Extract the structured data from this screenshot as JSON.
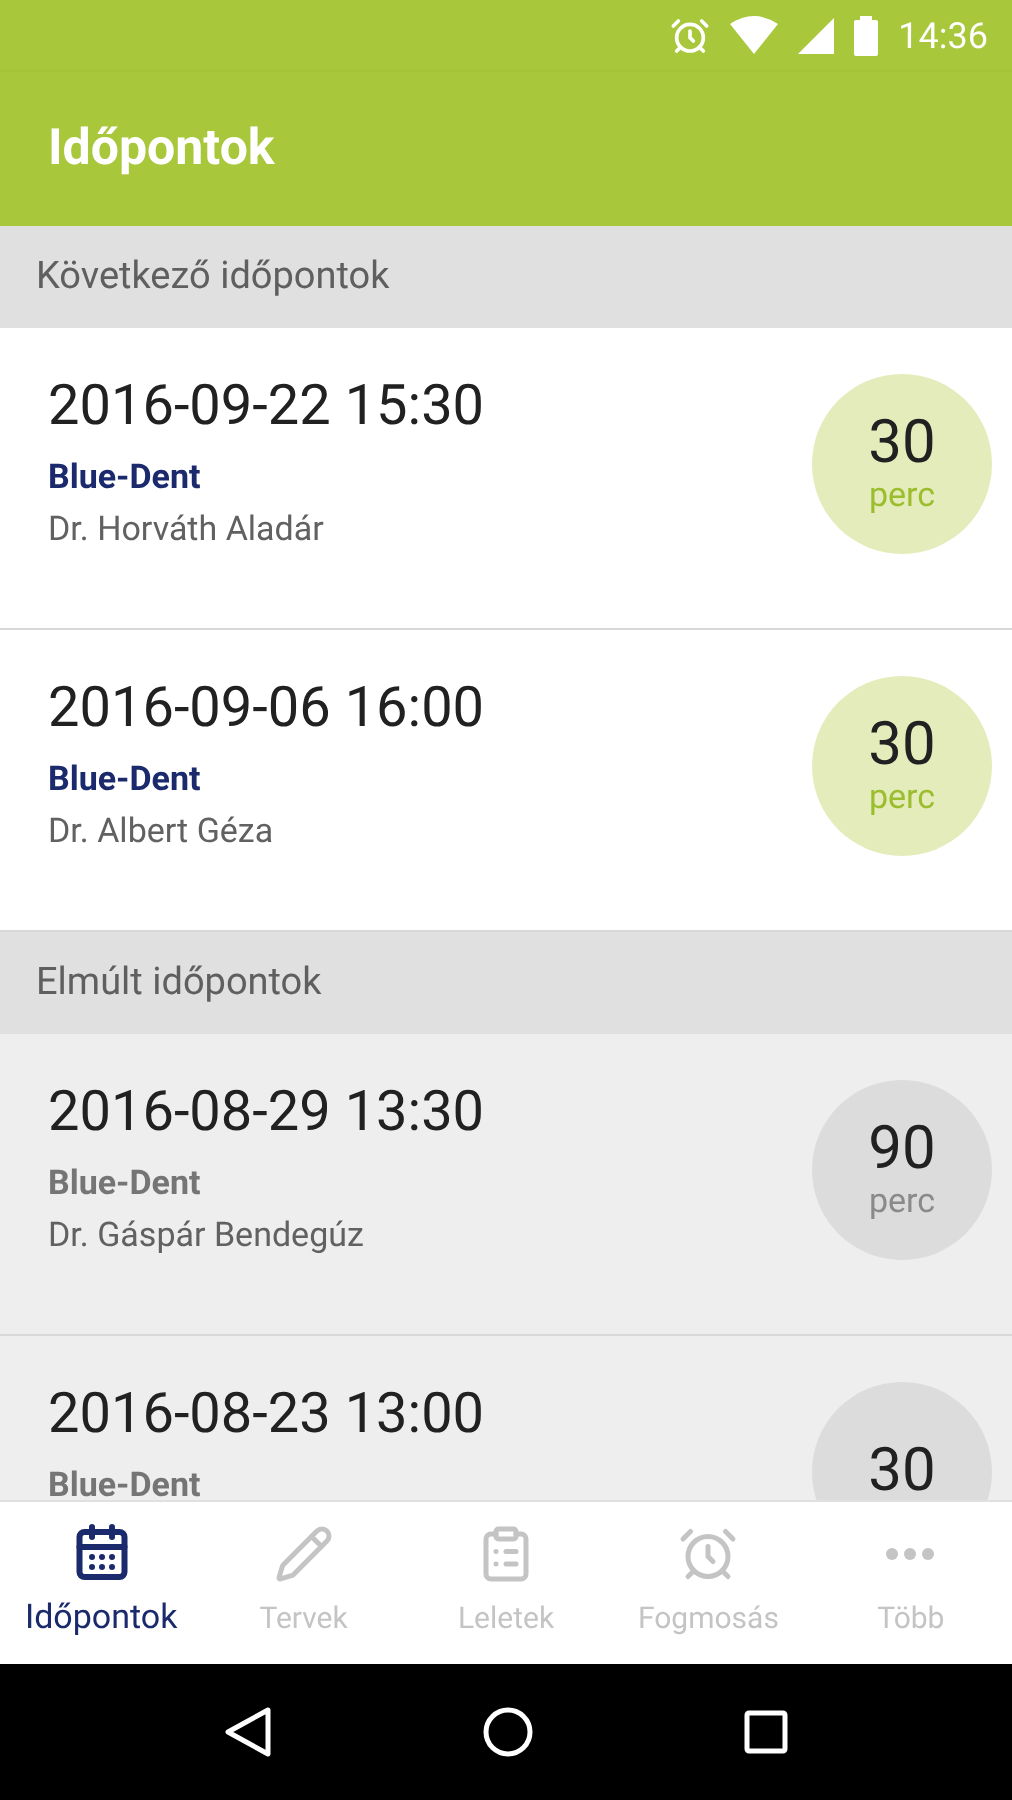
{
  "status_bar": {
    "time": "14:36"
  },
  "app_bar": {
    "title": "Időpontok"
  },
  "sections": [
    {
      "title": "Következő időpontok",
      "kind": "upcoming",
      "appointments": [
        {
          "datetime": "2016-09-22 15:30",
          "clinic": "Blue-Dent",
          "doctor": "Dr. Horváth Aladár",
          "duration": "30",
          "unit": "perc"
        },
        {
          "datetime": "2016-09-06 16:00",
          "clinic": "Blue-Dent",
          "doctor": "Dr. Albert Géza",
          "duration": "30",
          "unit": "perc"
        }
      ]
    },
    {
      "title": "Elmúlt időpontok",
      "kind": "past",
      "appointments": [
        {
          "datetime": "2016-08-29 13:30",
          "clinic": "Blue-Dent",
          "doctor": "Dr. Gáspár Bendegúz",
          "duration": "90",
          "unit": "perc"
        },
        {
          "datetime": "2016-08-23 13:00",
          "clinic": "Blue-Dent",
          "duration": "30"
        }
      ]
    }
  ],
  "bottom_nav": [
    {
      "label": "Időpontok",
      "kind": "calendar",
      "selected": true
    },
    {
      "label": "Tervek",
      "kind": "pencil",
      "selected": false
    },
    {
      "label": "Leletek",
      "kind": "clipboard",
      "selected": false
    },
    {
      "label": "Fogmosás",
      "kind": "alarm",
      "selected": false
    },
    {
      "label": "Több",
      "kind": "more",
      "selected": false
    }
  ]
}
